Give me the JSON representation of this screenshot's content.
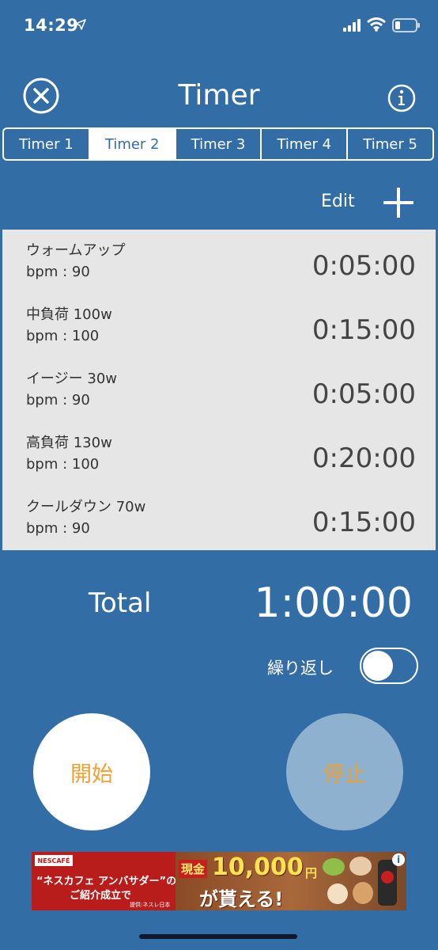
{
  "status_bar": {
    "time": "14:29"
  },
  "header": {
    "title": "Timer"
  },
  "tabs": [
    {
      "label": "Timer 1"
    },
    {
      "label": "Timer 2"
    },
    {
      "label": "Timer 3"
    },
    {
      "label": "Timer 4"
    },
    {
      "label": "Timer 5"
    }
  ],
  "selected_tab": "Timer 2",
  "toolbar": {
    "edit_label": "Edit"
  },
  "intervals": [
    {
      "name": "ウォームアップ",
      "bpm": "bpm : 90",
      "duration": "0:05:00"
    },
    {
      "name": "中負荷 100w",
      "bpm": "bpm : 100",
      "duration": "0:15:00"
    },
    {
      "name": "イージー  30w",
      "bpm": "bpm : 90",
      "duration": "0:05:00"
    },
    {
      "name": "高負荷 130w",
      "bpm": "bpm : 100",
      "duration": "0:20:00"
    },
    {
      "name": "クールダウン 70w",
      "bpm": "bpm : 90",
      "duration": "0:15:00"
    }
  ],
  "total": {
    "label": "Total",
    "value": "1:00:00"
  },
  "repeat": {
    "label": "繰り返し",
    "on": false
  },
  "controls": {
    "start_label": "開始",
    "stop_label": "停止"
  },
  "ad": {
    "brand": "NESCAFÉ",
    "line1": "“ネスカフェ アンバサダー”の",
    "line2": "ご紹介成立で",
    "source": "提供:ネスレ日本",
    "cash_label": "現金",
    "amount": "10,000",
    "yen": "円",
    "tagline": "が貰える!"
  },
  "colors": {
    "background": "#336da5",
    "accent": "#f0a030",
    "list_bg": "#e6e6e6"
  }
}
